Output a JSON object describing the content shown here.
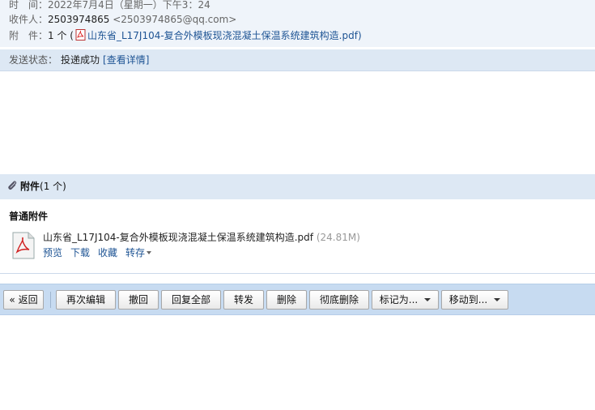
{
  "header": {
    "time_label": "时　间：",
    "time_value": "2022年7月4日（星期一）下午3：24",
    "recipient_label": "收件人：",
    "recipient_name": "2503974865",
    "recipient_email": "<2503974865@qq.com>",
    "attachment_label": "附　件：",
    "attachment_count": "1 个 (",
    "attachment_name": "山东省_L17J104-复合外模板现浇混凝土保温系统建筑构造.pdf",
    "attachment_close": ")"
  },
  "status": {
    "label": "发送状态：",
    "value": "投递成功",
    "details_link": "[查看详情]"
  },
  "attachments": {
    "title": "附件",
    "count": "(1 个)",
    "subtitle": "普通附件",
    "file": {
      "name": "山东省_L17J104-复合外模板现浇混凝土保温系统建筑构造.pdf",
      "size": "(24.81M)",
      "icon": "pdf-file-icon"
    },
    "actions": {
      "preview": "预览",
      "download": "下载",
      "favorite": "收藏",
      "save_to": "转存"
    }
  },
  "toolbar": {
    "back": "« 返回",
    "edit_again": "再次编辑",
    "recall": "撤回",
    "reply_all": "回复全部",
    "forward": "转发",
    "delete": "删除",
    "delete_permanently": "彻底删除",
    "mark_as": "标记为...",
    "move_to": "移动到..."
  },
  "colors": {
    "link": "#1e5494",
    "header_bg": "#eff4fa",
    "bar_bg": "#dde8f4",
    "toolbar_bg": "#c7dbf1"
  }
}
